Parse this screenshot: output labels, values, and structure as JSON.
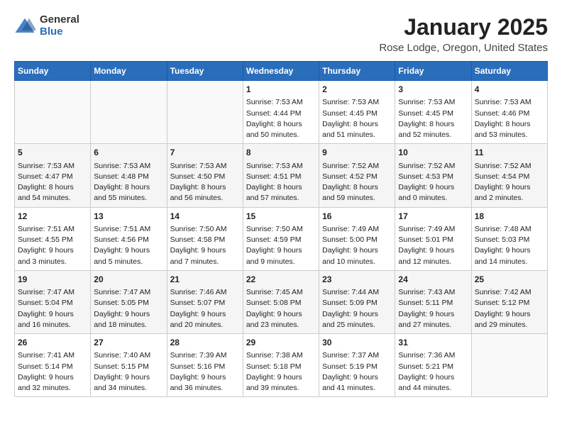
{
  "logo": {
    "general": "General",
    "blue": "Blue"
  },
  "title": "January 2025",
  "subtitle": "Rose Lodge, Oregon, United States",
  "days_of_week": [
    "Sunday",
    "Monday",
    "Tuesday",
    "Wednesday",
    "Thursday",
    "Friday",
    "Saturday"
  ],
  "weeks": [
    [
      {
        "day": "",
        "info": ""
      },
      {
        "day": "",
        "info": ""
      },
      {
        "day": "",
        "info": ""
      },
      {
        "day": "1",
        "info": "Sunrise: 7:53 AM\nSunset: 4:44 PM\nDaylight: 8 hours\nand 50 minutes."
      },
      {
        "day": "2",
        "info": "Sunrise: 7:53 AM\nSunset: 4:45 PM\nDaylight: 8 hours\nand 51 minutes."
      },
      {
        "day": "3",
        "info": "Sunrise: 7:53 AM\nSunset: 4:45 PM\nDaylight: 8 hours\nand 52 minutes."
      },
      {
        "day": "4",
        "info": "Sunrise: 7:53 AM\nSunset: 4:46 PM\nDaylight: 8 hours\nand 53 minutes."
      }
    ],
    [
      {
        "day": "5",
        "info": "Sunrise: 7:53 AM\nSunset: 4:47 PM\nDaylight: 8 hours\nand 54 minutes."
      },
      {
        "day": "6",
        "info": "Sunrise: 7:53 AM\nSunset: 4:48 PM\nDaylight: 8 hours\nand 55 minutes."
      },
      {
        "day": "7",
        "info": "Sunrise: 7:53 AM\nSunset: 4:50 PM\nDaylight: 8 hours\nand 56 minutes."
      },
      {
        "day": "8",
        "info": "Sunrise: 7:53 AM\nSunset: 4:51 PM\nDaylight: 8 hours\nand 57 minutes."
      },
      {
        "day": "9",
        "info": "Sunrise: 7:52 AM\nSunset: 4:52 PM\nDaylight: 8 hours\nand 59 minutes."
      },
      {
        "day": "10",
        "info": "Sunrise: 7:52 AM\nSunset: 4:53 PM\nDaylight: 9 hours\nand 0 minutes."
      },
      {
        "day": "11",
        "info": "Sunrise: 7:52 AM\nSunset: 4:54 PM\nDaylight: 9 hours\nand 2 minutes."
      }
    ],
    [
      {
        "day": "12",
        "info": "Sunrise: 7:51 AM\nSunset: 4:55 PM\nDaylight: 9 hours\nand 3 minutes."
      },
      {
        "day": "13",
        "info": "Sunrise: 7:51 AM\nSunset: 4:56 PM\nDaylight: 9 hours\nand 5 minutes."
      },
      {
        "day": "14",
        "info": "Sunrise: 7:50 AM\nSunset: 4:58 PM\nDaylight: 9 hours\nand 7 minutes."
      },
      {
        "day": "15",
        "info": "Sunrise: 7:50 AM\nSunset: 4:59 PM\nDaylight: 9 hours\nand 9 minutes."
      },
      {
        "day": "16",
        "info": "Sunrise: 7:49 AM\nSunset: 5:00 PM\nDaylight: 9 hours\nand 10 minutes."
      },
      {
        "day": "17",
        "info": "Sunrise: 7:49 AM\nSunset: 5:01 PM\nDaylight: 9 hours\nand 12 minutes."
      },
      {
        "day": "18",
        "info": "Sunrise: 7:48 AM\nSunset: 5:03 PM\nDaylight: 9 hours\nand 14 minutes."
      }
    ],
    [
      {
        "day": "19",
        "info": "Sunrise: 7:47 AM\nSunset: 5:04 PM\nDaylight: 9 hours\nand 16 minutes."
      },
      {
        "day": "20",
        "info": "Sunrise: 7:47 AM\nSunset: 5:05 PM\nDaylight: 9 hours\nand 18 minutes."
      },
      {
        "day": "21",
        "info": "Sunrise: 7:46 AM\nSunset: 5:07 PM\nDaylight: 9 hours\nand 20 minutes."
      },
      {
        "day": "22",
        "info": "Sunrise: 7:45 AM\nSunset: 5:08 PM\nDaylight: 9 hours\nand 23 minutes."
      },
      {
        "day": "23",
        "info": "Sunrise: 7:44 AM\nSunset: 5:09 PM\nDaylight: 9 hours\nand 25 minutes."
      },
      {
        "day": "24",
        "info": "Sunrise: 7:43 AM\nSunset: 5:11 PM\nDaylight: 9 hours\nand 27 minutes."
      },
      {
        "day": "25",
        "info": "Sunrise: 7:42 AM\nSunset: 5:12 PM\nDaylight: 9 hours\nand 29 minutes."
      }
    ],
    [
      {
        "day": "26",
        "info": "Sunrise: 7:41 AM\nSunset: 5:14 PM\nDaylight: 9 hours\nand 32 minutes."
      },
      {
        "day": "27",
        "info": "Sunrise: 7:40 AM\nSunset: 5:15 PM\nDaylight: 9 hours\nand 34 minutes."
      },
      {
        "day": "28",
        "info": "Sunrise: 7:39 AM\nSunset: 5:16 PM\nDaylight: 9 hours\nand 36 minutes."
      },
      {
        "day": "29",
        "info": "Sunrise: 7:38 AM\nSunset: 5:18 PM\nDaylight: 9 hours\nand 39 minutes."
      },
      {
        "day": "30",
        "info": "Sunrise: 7:37 AM\nSunset: 5:19 PM\nDaylight: 9 hours\nand 41 minutes."
      },
      {
        "day": "31",
        "info": "Sunrise: 7:36 AM\nSunset: 5:21 PM\nDaylight: 9 hours\nand 44 minutes."
      },
      {
        "day": "",
        "info": ""
      }
    ]
  ]
}
